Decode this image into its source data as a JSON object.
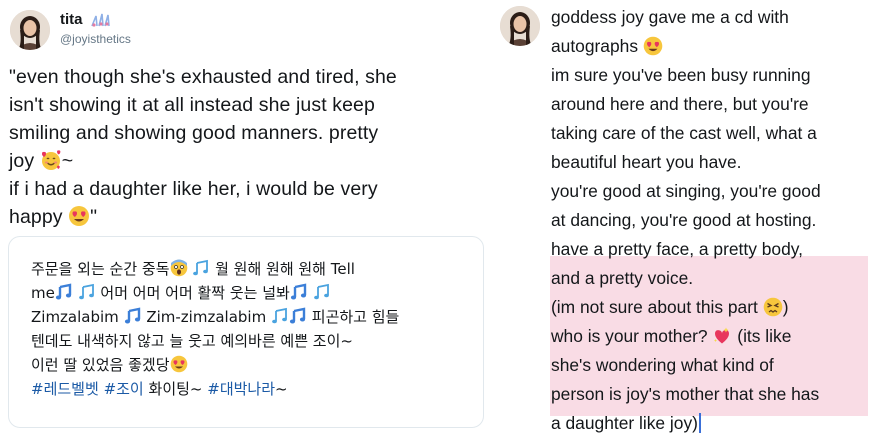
{
  "left": {
    "user_name": "tita",
    "user_handle": "@joyisthetics",
    "tweet_lines": [
      "\"even though she's exhausted and tired, she",
      "isn't showing it at all instead she just keep",
      "smiling and showing good manners. pretty",
      "joy",
      "~",
      "if i had a daughter like her, i would be very",
      "happy",
      "\""
    ],
    "quote_lines": [
      "주문을 외는 순간 중독",
      "월 원해 원해 원해 Tell",
      "me",
      "어머 어머 어머 활짝 웃는 널봐",
      "Zimzalabim",
      "Zim-zimzalabim",
      "피곤하고 힘들",
      "텐데도 내색하지 않고 늘 웃고 예의바른 예쁜 조이",
      "~",
      "이런 딸 있었음 좋겠당",
      "#레드벨벳",
      "#조이",
      "화이팅~",
      "#대박나라",
      "~"
    ]
  },
  "right": {
    "lines": [
      "goddess joy gave me a cd with",
      "autographs",
      "im sure you've been busy running",
      "around here and there, but you're",
      "taking care of the cast well, what a",
      "beautiful heart you have.",
      "you're good at singing, you're good",
      "at dancing, you're good at hosting.",
      "have a pretty face, a pretty body,",
      "and a pretty voice.",
      "(im not sure about this part",
      ")",
      "who is your mother?",
      "(its like",
      "she's wondering what kind of",
      "person is joy's mother that she has",
      "a daughter like joy)"
    ]
  },
  "colors": {
    "text": "#14171a",
    "handle": "#657786",
    "hashtag": "#1b5aa6",
    "highlight": "#f9dce5",
    "caret": "#3a6fd8",
    "card_border": "#e1e8ed"
  },
  "icons": {
    "left_avatar": "avatar-photo",
    "name_emoji": "music-bars-emoji",
    "joy_emoji": "smiling-face-with-hearts-emoji",
    "happy_emoji": "heart-eyes-emoji",
    "quote_emojis": [
      "scream-emoji",
      "music-notes-emoji",
      "music-note-emoji",
      "heart-eyes-emoji"
    ],
    "right_emojis": [
      "heart-eyes-emoji",
      "persevering-face-emoji",
      "sparkling-heart-emoji"
    ]
  }
}
